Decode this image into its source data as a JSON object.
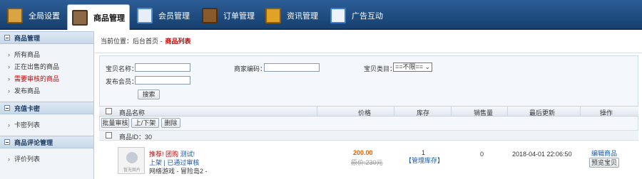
{
  "nav": {
    "items": [
      {
        "label": "全局设置",
        "icon": "settings-window-icon",
        "color": "#d9a441"
      },
      {
        "label": "商品管理",
        "icon": "goods-grid-icon",
        "color": "#8b6a45"
      },
      {
        "label": "会员管理",
        "icon": "member-card-icon",
        "color": "#4f8cc9"
      },
      {
        "label": "订单管理",
        "icon": "order-book-icon",
        "color": "#8b5a2b"
      },
      {
        "label": "资讯管理",
        "icon": "news-folder-icon",
        "color": "#e0a227"
      },
      {
        "label": "广告互动",
        "icon": "ad-document-icon",
        "color": "#3b7bd4"
      }
    ]
  },
  "sidebar": {
    "sections": [
      {
        "title": "商品管理",
        "items": [
          "所有商品",
          "正在出售的商品",
          "需要审核的商品",
          "发布商品"
        ]
      },
      {
        "title": "充值卡密",
        "items": [
          "卡密列表"
        ]
      },
      {
        "title": "商品评论管理",
        "items": [
          "评价列表"
        ]
      }
    ]
  },
  "breadcrumb": {
    "prefix": "当前位置：后台首页 -",
    "current": "商品列表"
  },
  "filter": {
    "name_label": "宝贝名称：",
    "code_label": "商家编码：",
    "category_label": "宝贝类目：",
    "category_value": "==不限==",
    "seller_label": "发布会员：",
    "search_button": "搜索",
    "name_value": "",
    "code_value": "",
    "seller_value": ""
  },
  "table": {
    "headers": {
      "name": "商品名称",
      "price": "价格",
      "stock": "库存",
      "sales": "销售量",
      "updated": "最后更新",
      "action": "操作"
    },
    "actions": [
      "批量审核",
      "上/下架",
      "删除"
    ],
    "id_row": "商品ID：30",
    "product": {
      "tags": [
        "推荐!",
        "团购",
        "测试!"
      ],
      "status1": "上架",
      "status_sep": "|",
      "status2": "已通过审核",
      "line3": "网络游戏 - 冒险岛2 -",
      "thumb_text": "暂无图片",
      "price": "200.00",
      "old_price": "原价:230元",
      "stock": "1",
      "stock_manage": "【管理库存】",
      "sales": "0",
      "updated": "2018-04-01 22:06:50",
      "edit": "编辑商品",
      "preview": "预览宝贝"
    }
  }
}
